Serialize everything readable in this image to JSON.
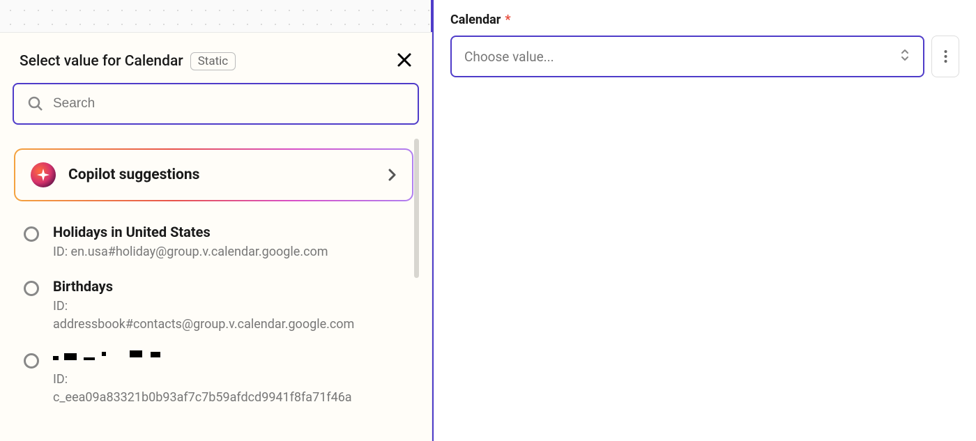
{
  "right": {
    "field_label": "Calendar",
    "required": "*",
    "placeholder": "Choose value..."
  },
  "panel": {
    "title": "Select value for Calendar",
    "badge": "Static",
    "search_placeholder": "Search",
    "copilot_label": "Copilot suggestions",
    "options": [
      {
        "title": "Holidays in United States",
        "id_label": "ID: en.usa#holiday@group.v.calendar.google.com"
      },
      {
        "title": "Birthdays",
        "id_label_prefix": "ID:",
        "id_value": "addressbook#contacts@group.v.calendar.google.com"
      },
      {
        "title_redacted": true,
        "id_label_prefix": "ID:",
        "id_value": "c_eea09a83321b0b93af7c7b59afdcd9941f8fa71f46a"
      }
    ]
  }
}
